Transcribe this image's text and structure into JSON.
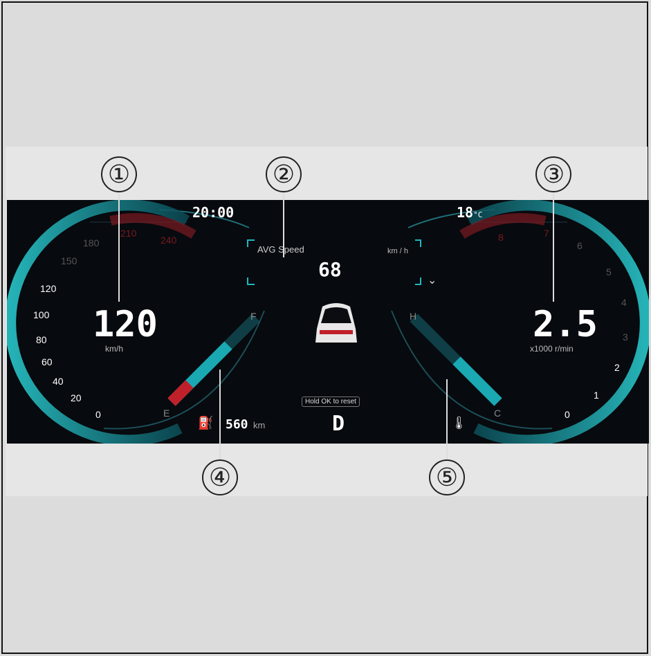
{
  "callouts": [
    "①",
    "②",
    "③",
    "④",
    "⑤"
  ],
  "cluster": {
    "time": "20:00",
    "outside_temp": "18",
    "outside_temp_unit": "°C",
    "speed_value": "120",
    "speed_unit": "km/h",
    "speed_ticks": [
      "0",
      "20",
      "40",
      "60",
      "80",
      "100",
      "120",
      "150",
      "180",
      "210",
      "240"
    ],
    "avg_label": "AVG Speed",
    "avg_value": "68",
    "avg_unit": "km / h",
    "reset_hint": "Hold OK to reset",
    "gear": "D",
    "range_value": "560",
    "range_unit": "km",
    "fuel_full": "F",
    "fuel_empty": "E",
    "temp_hot": "H",
    "temp_cold": "C",
    "rpm_value": "2.5",
    "rpm_unit": "x1000 r/min",
    "rpm_ticks": [
      "0",
      "1",
      "2",
      "3",
      "4",
      "5",
      "6",
      "7",
      "8"
    ],
    "fuel_level": 0.75,
    "coolant_level": 0.5
  },
  "colors": {
    "accent": "#1fb8c0",
    "warning": "#c0202a",
    "background": "#070a0e"
  },
  "icons": [
    "fuel-pump-icon",
    "coolant-thermometer-icon",
    "car-rear-icon",
    "chevron-down-icon"
  ]
}
